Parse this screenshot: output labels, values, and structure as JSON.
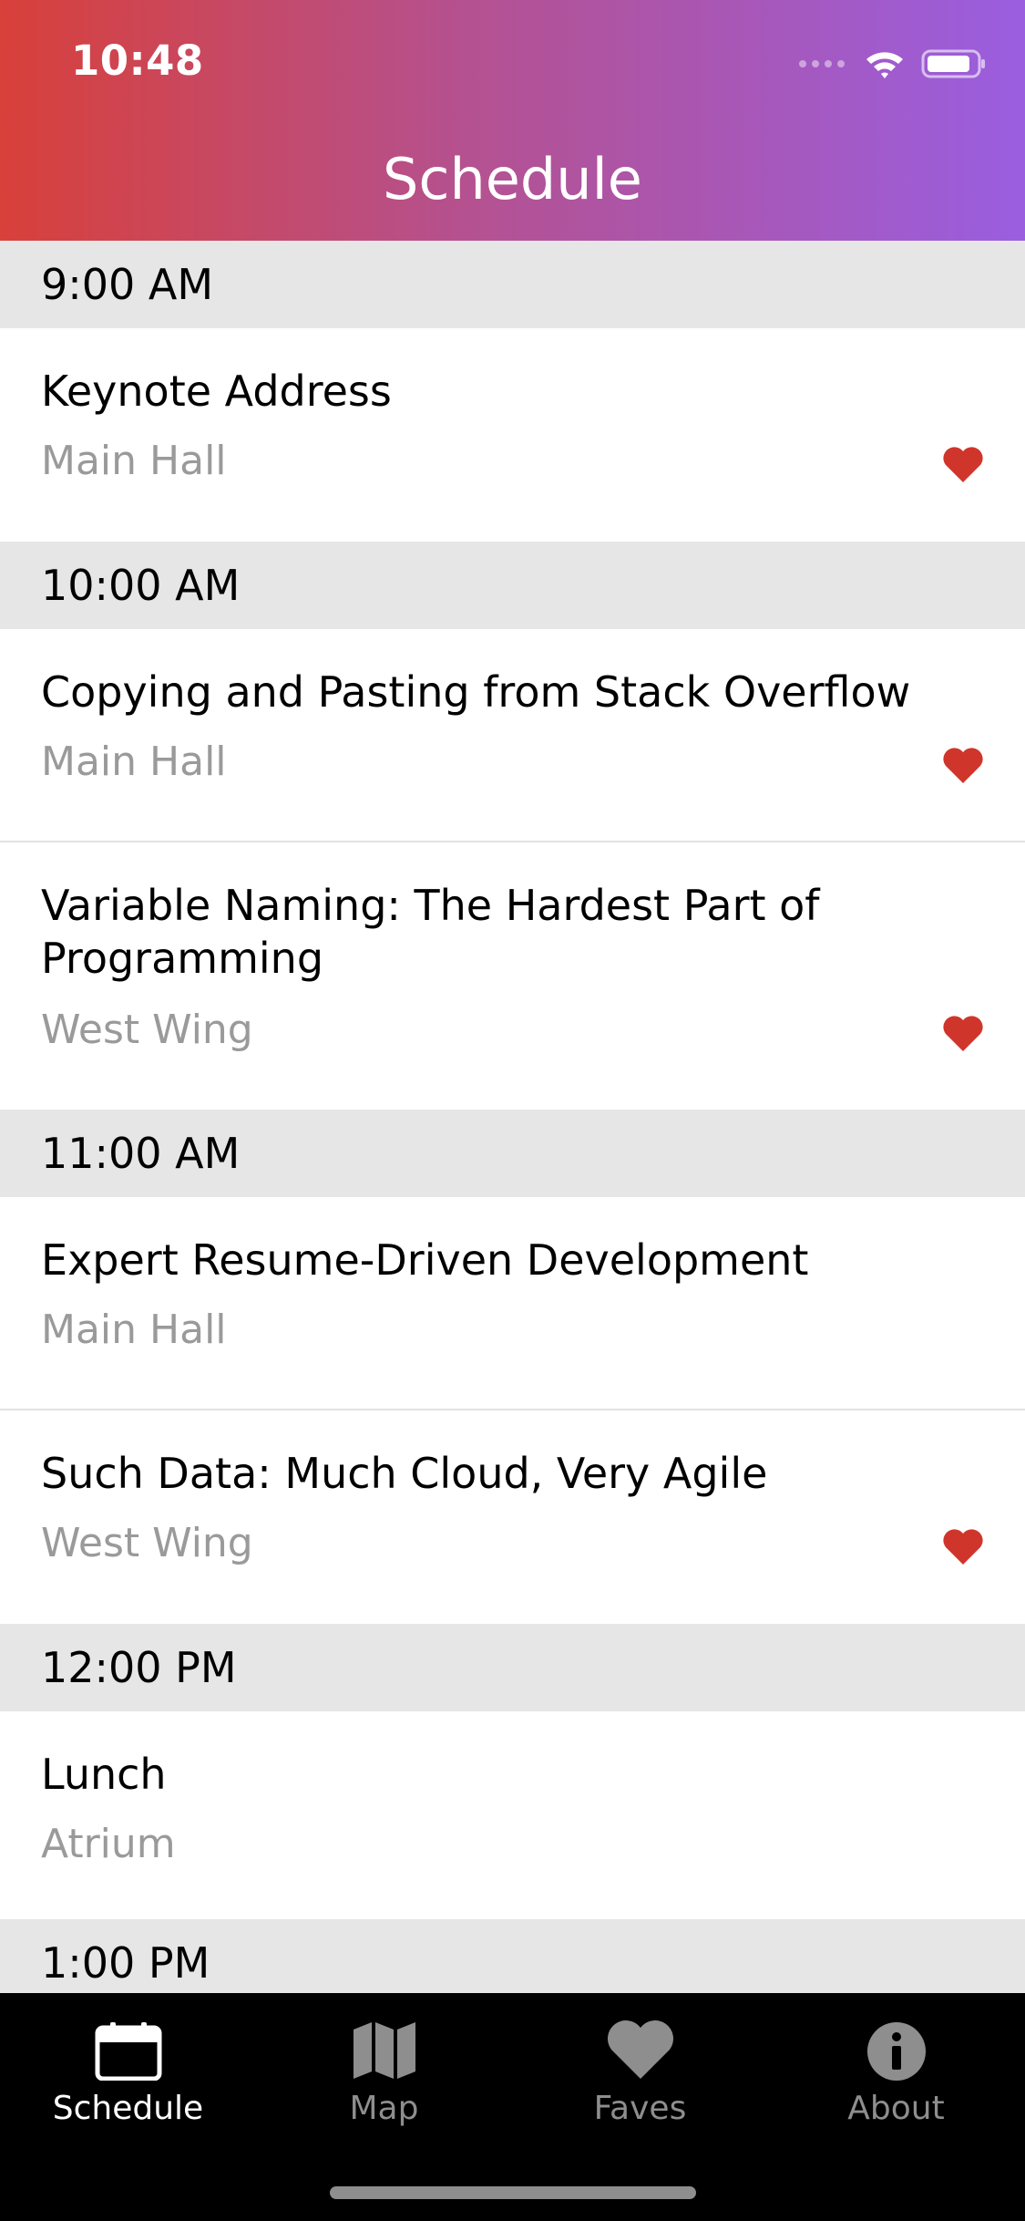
{
  "status_bar": {
    "time": "10:48"
  },
  "header": {
    "title": "Schedule"
  },
  "sections": [
    {
      "time": "9:00 AM",
      "items": [
        {
          "title": "Keynote Address",
          "location": "Main Hall",
          "favorite": true
        }
      ]
    },
    {
      "time": "10:00 AM",
      "items": [
        {
          "title": "Copying and Pasting from Stack Overflow",
          "location": "Main Hall",
          "favorite": true
        },
        {
          "title": "Variable Naming: The Hardest Part of Programming",
          "location": "West Wing",
          "favorite": true
        }
      ]
    },
    {
      "time": "11:00 AM",
      "items": [
        {
          "title": "Expert Resume-Driven Development",
          "location": "Main Hall",
          "favorite": false
        },
        {
          "title": "Such Data: Much Cloud, Very Agile",
          "location": "West Wing",
          "favorite": true
        }
      ]
    },
    {
      "time": "12:00 PM",
      "items": [
        {
          "title": "Lunch",
          "location": "Atrium",
          "favorite": false
        }
      ]
    },
    {
      "time": "1:00 PM",
      "items": []
    }
  ],
  "tabs": [
    {
      "label": "Schedule",
      "icon": "calendar-icon",
      "active": true
    },
    {
      "label": "Map",
      "icon": "map-icon",
      "active": false
    },
    {
      "label": "Faves",
      "icon": "heart-icon",
      "active": false
    },
    {
      "label": "About",
      "icon": "info-icon",
      "active": false
    }
  ],
  "colors": {
    "heart": "#d0352b",
    "header_start": "#d8403a",
    "header_end": "#9a5ee0"
  }
}
